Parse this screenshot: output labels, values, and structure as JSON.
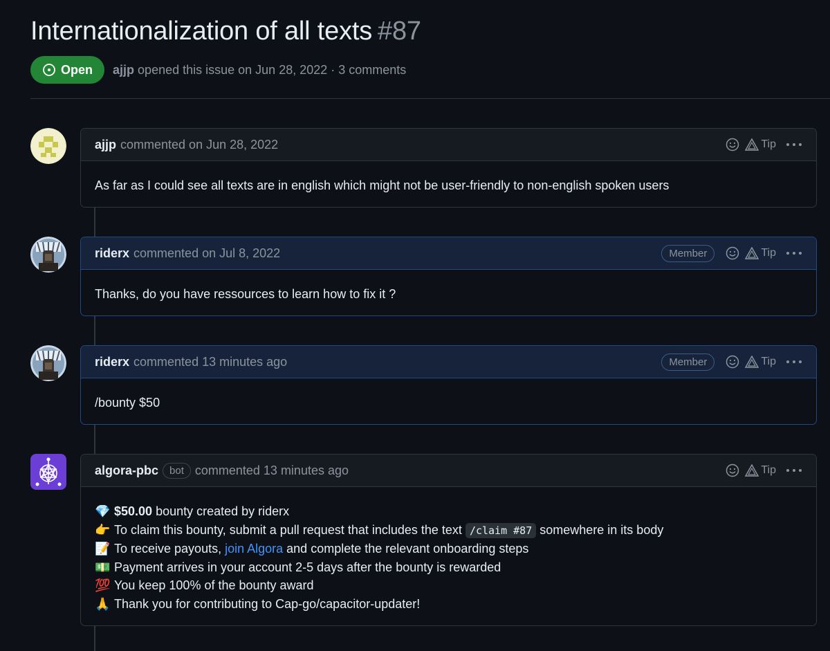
{
  "issue": {
    "title": "Internationalization of all texts",
    "number": "#87",
    "state": "Open",
    "author": "ajjp",
    "meta": "opened this issue on Jun 28, 2022 · 3 comments"
  },
  "actions": {
    "tip_label": "Tip"
  },
  "comments": [
    {
      "author": "ajjp",
      "time": "commented on Jun 28, 2022",
      "role": "",
      "body": "As far as I could see all texts are in english which might not be user-friendly to non-english spoken users"
    },
    {
      "author": "riderx",
      "time": "commented on Jul 8, 2022",
      "role": "Member",
      "body": "Thanks, do you have ressources to learn how to fix it ?"
    },
    {
      "author": "riderx",
      "time": "commented 13 minutes ago",
      "role": "Member",
      "body": "/bounty $50"
    },
    {
      "author": "algora-pbc",
      "badge": "bot",
      "time": "commented 13 minutes ago",
      "role": "",
      "lines": {
        "l1_emoji": "💎",
        "l1_amount": "$50.00",
        "l1_text": " bounty created by riderx",
        "l2_emoji": "👉",
        "l2_pre": "To claim this bounty, submit a pull request that includes the text ",
        "l2_code": "/claim #87",
        "l2_post": " somewhere in its body",
        "l3_emoji": "📝",
        "l3_pre": "To receive payouts, ",
        "l3_link": "join Algora",
        "l3_post": " and complete the relevant onboarding steps",
        "l4_emoji": "💵",
        "l4_text": "Payment arrives in your account 2-5 days after the bounty is rewarded",
        "l5_emoji": "💯",
        "l5_text": "You keep 100% of the bounty award",
        "l6_emoji": "🙏",
        "l6_text": "Thank you for contributing to Cap-go/capacitor-updater!"
      }
    }
  ],
  "colors": {
    "background": "#0d1117",
    "open_green": "#238636",
    "member_border": "#1f4a86",
    "link": "#4493f8",
    "algora_purple": "#6b3fd6"
  }
}
